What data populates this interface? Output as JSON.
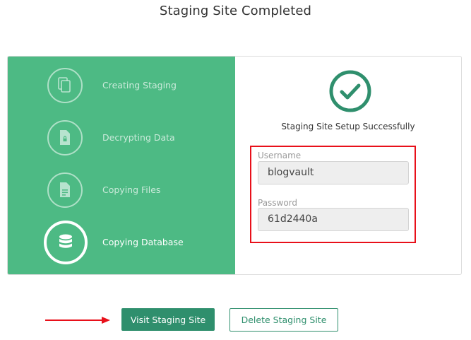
{
  "title": "Staging Site Completed",
  "steps": [
    {
      "label": "Creating Staging",
      "icon": "copy-icon",
      "active": false
    },
    {
      "label": "Decrypting Data",
      "icon": "locked-file-icon",
      "active": false
    },
    {
      "label": "Copying Files",
      "icon": "document-icon",
      "active": false
    },
    {
      "label": "Copying Database",
      "icon": "database-icon",
      "active": true
    }
  ],
  "result": {
    "message": "Staging Site Setup Successfully",
    "icon": "check-circle-icon",
    "username_label": "Username",
    "username_value": "blogvault",
    "password_label": "Password",
    "password_value": "61d2440a"
  },
  "actions": {
    "visit_label": "Visit Staging Site",
    "delete_label": "Delete Staging Site"
  },
  "colors": {
    "green_panel": "#4dba84",
    "teal_button": "#2f8f6d",
    "highlight_red": "#e8101a"
  }
}
